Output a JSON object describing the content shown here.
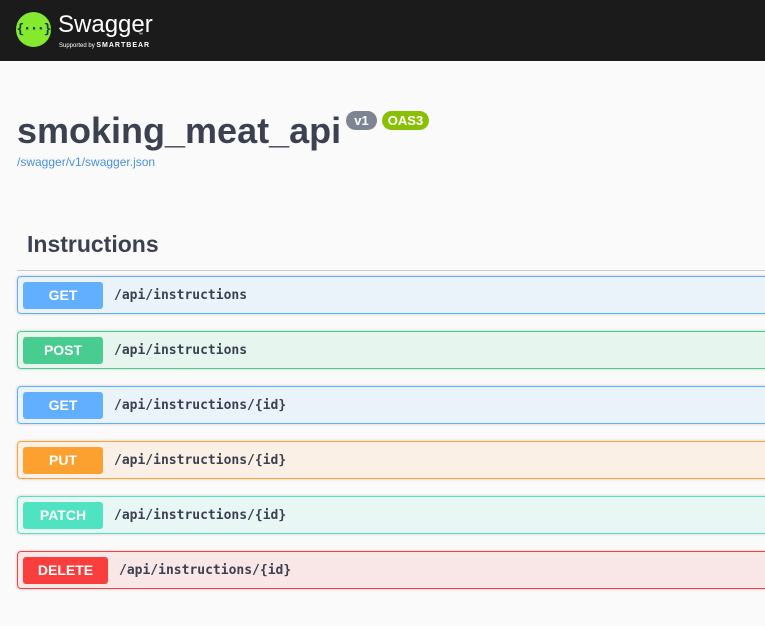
{
  "topbar": {
    "logo_glyph": "{···}",
    "brand": "Swagger",
    "trademark": "™",
    "supported_by": "Supported by",
    "company": "SMARTBEAR",
    "background": "#1b1b1b",
    "logo_color": "#85ea2d"
  },
  "info": {
    "title": "smoking_meat_api",
    "version": "v1",
    "oas": "OAS3",
    "spec_url": "/swagger/v1/swagger.json"
  },
  "tag": {
    "name": "Instructions"
  },
  "operations": [
    {
      "method": "GET",
      "path": "/api/instructions",
      "color": "#61affe"
    },
    {
      "method": "POST",
      "path": "/api/instructions",
      "color": "#49cc90"
    },
    {
      "method": "GET",
      "path": "/api/instructions/{id}",
      "color": "#61affe"
    },
    {
      "method": "PUT",
      "path": "/api/instructions/{id}",
      "color": "#fca130"
    },
    {
      "method": "PATCH",
      "path": "/api/instructions/{id}",
      "color": "#50e3c2"
    },
    {
      "method": "DELETE",
      "path": "/api/instructions/{id}",
      "color": "#f93e3e"
    }
  ]
}
